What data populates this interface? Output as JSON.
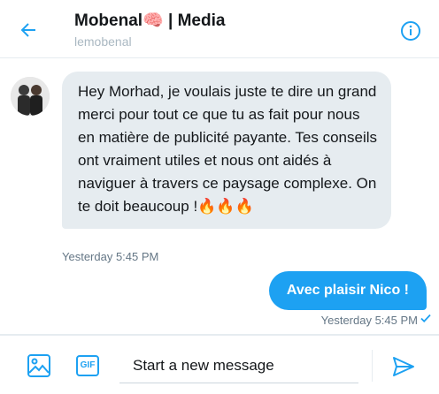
{
  "header": {
    "title": "Mobenal🧠 | Media",
    "subtitle": "lemobenal",
    "back_icon": "back-arrow-icon",
    "info_icon": "info-icon"
  },
  "messages": {
    "incoming": {
      "text": "Hey Morhad, je voulais juste te dire un grand merci pour tout ce que tu as fait pour nous en matière de publicité payante. Tes conseils ont vraiment utiles et nous ont aidés à naviguer à travers ce paysage complexe. On te doit beaucoup !🔥🔥🔥",
      "time": "Yesterday 5:45 PM"
    },
    "outgoing": {
      "text": "Avec plaisir Nico !",
      "time": "Yesterday 5:45 PM"
    }
  },
  "composer": {
    "placeholder": "Start a new message",
    "gif_label": "GIF",
    "media_icon": "image-icon",
    "send_icon": "send-icon"
  },
  "colors": {
    "accent": "#1da1f2",
    "incoming_bubble": "#e6ecf0",
    "muted_text": "#657786"
  }
}
